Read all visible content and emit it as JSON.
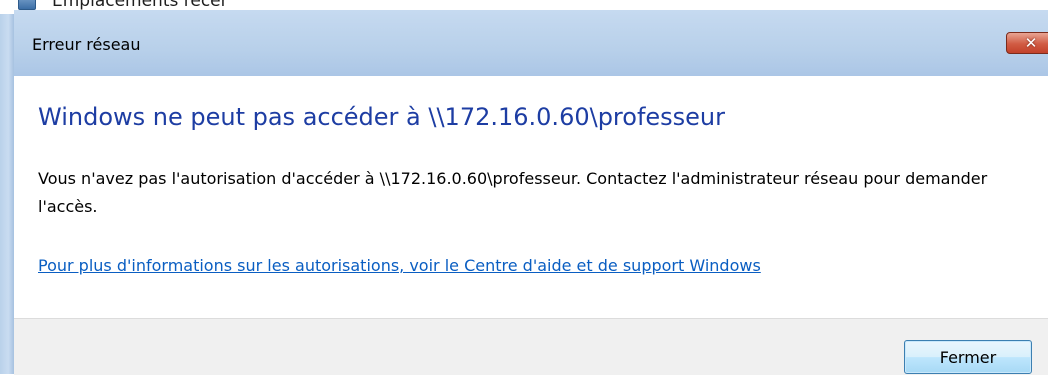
{
  "background_window": {
    "item_label": "Emplacements récer",
    "icon": "folder-icon"
  },
  "dialog": {
    "title": "Erreur réseau",
    "close_glyph": "✕",
    "heading": "Windows ne peut pas accéder à \\\\172.16.0.60\\professeur",
    "message": "Vous n'avez pas l'autorisation d'accéder à \\\\172.16.0.60\\professeur. Contactez l'administrateur réseau pour demander l'accès.",
    "help_link": "Pour plus d'informations sur les autorisations, voir le Centre d'aide et de support Windows",
    "buttons": {
      "close_label": "Fermer"
    }
  },
  "colors": {
    "heading": "#1d3da3",
    "link": "#0a5ec2",
    "titlebar": "#b8d0ea",
    "close_button": "#d15b43",
    "footer": "#f0f0f0"
  }
}
